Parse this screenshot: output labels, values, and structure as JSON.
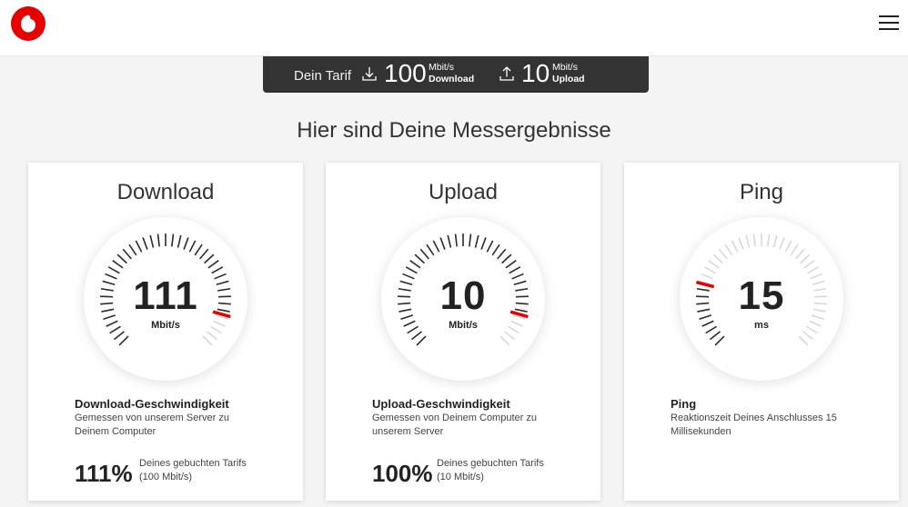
{
  "header": {
    "logo_icon": "vodafone-speechmark-icon",
    "menu_icon": "hamburger-menu-icon",
    "brand_color": "#e60000"
  },
  "tariff": {
    "label": "Dein Tarif",
    "download": {
      "icon": "download-icon",
      "value": "100",
      "unit": "Mbit/s",
      "caption": "Download"
    },
    "upload": {
      "icon": "upload-icon",
      "value": "10",
      "unit": "Mbit/s",
      "caption": "Upload"
    }
  },
  "headline": "Hier sind Deine Messergebnisse",
  "cards": [
    {
      "title": "Download",
      "value": "111",
      "unit": "Mbit/s",
      "gauge_fraction": 0.89,
      "heading": "Download-Geschwindigkeit",
      "description": "Gemessen von unserem Server zu Deinem Computer",
      "percent": "111%",
      "percent_text_1": "Deines gebuchten Tarifs",
      "percent_text_2": "(100 Mbit/s)"
    },
    {
      "title": "Upload",
      "value": "10",
      "unit": "Mbit/s",
      "gauge_fraction": 0.89,
      "heading": "Upload-Geschwindigkeit",
      "description": "Gemessen von Deinem Computer zu unserem Server",
      "percent": "100%",
      "percent_text_1": "Deines gebuchten Tarifs",
      "percent_text_2": "(10 Mbit/s)"
    },
    {
      "title": "Ping",
      "value": "15",
      "unit": "ms",
      "gauge_fraction": 0.22,
      "heading": "Ping",
      "description": "Reaktionszeit Deines Anschlusses 15 Millisekunden"
    }
  ],
  "colors": {
    "needle": "#e60000",
    "tick_active": "#2b2b2b",
    "tick_inactive": "#d8d8d8",
    "tariff_bar": "#333333"
  }
}
